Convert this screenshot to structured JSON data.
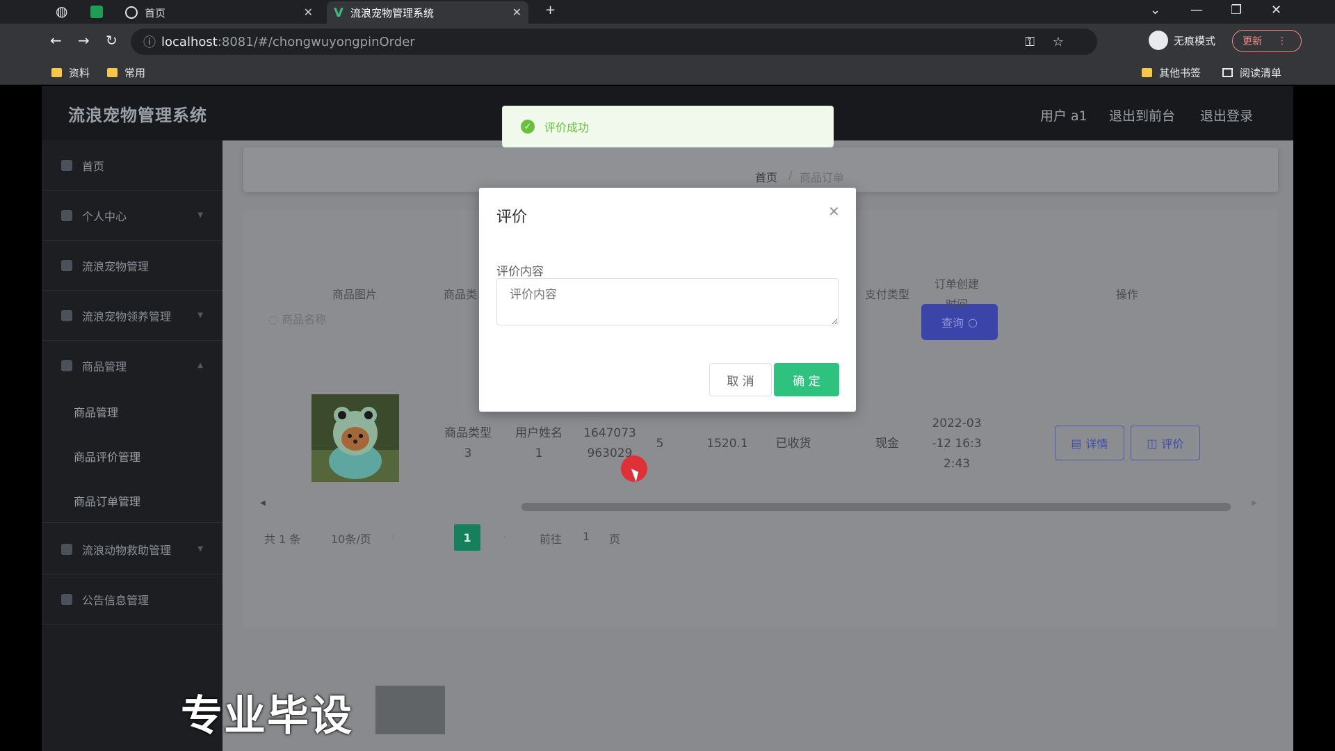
{
  "browser": {
    "tabs": [
      {
        "label": "首页"
      },
      {
        "label": "流浪宠物管理系统"
      }
    ],
    "url_host": "localhost",
    "url_rest": ":8081/#/chongwuyongpinOrder",
    "incognito_label": "无痕模式",
    "update_label": "更新",
    "bookmarks": [
      "资料",
      "常用"
    ],
    "other_bookmarks": "其他书签",
    "reading_list": "阅读清单"
  },
  "app": {
    "title": "流浪宠物管理系统",
    "header_links": [
      "用户 a1",
      "退出到前台",
      "退出登录"
    ]
  },
  "sidebar": {
    "items": [
      {
        "label": "首页"
      },
      {
        "label": "个人中心"
      },
      {
        "label": "流浪宠物管理"
      },
      {
        "label": "流浪宠物领养管理"
      },
      {
        "label": "商品管理"
      },
      {
        "label": "流浪动物救助管理"
      },
      {
        "label": "公告信息管理"
      }
    ],
    "sub_items": [
      "商品管理",
      "商品评价管理",
      "商品订单管理"
    ]
  },
  "breadcrumb": {
    "home": "首页",
    "current": "商品订单"
  },
  "search": {
    "label": "商品名称",
    "query_button": "查询"
  },
  "table": {
    "headers": {
      "image": "商品图片",
      "type": "商品类",
      "pay_type": "支付类型",
      "created_l1": "订单创建",
      "created_l2": "时间",
      "ops": "操作"
    },
    "row": {
      "type_l1": "商品类型",
      "type_l2": "3",
      "user_l1": "用户姓名",
      "user_l2": "1",
      "order_l1": "1647073",
      "order_l2": "963029",
      "qty": "5",
      "price": "1520.1",
      "status": "已收货",
      "pay": "现金",
      "time_l1": "2022-03",
      "time_l2": "-12 16:3",
      "time_l3": "2:43",
      "detail_btn": "详情",
      "review_btn": "评价"
    }
  },
  "pagination": {
    "total": "共 1 条",
    "per_page": "10条/页",
    "current": "1",
    "goto": "前往",
    "goto_value": "1",
    "page_unit": "页"
  },
  "dialog": {
    "title": "评价",
    "field_label": "评价内容",
    "placeholder": "评价内容",
    "cancel": "取 消",
    "confirm": "确 定"
  },
  "toast": {
    "message": "评价成功"
  },
  "watermark": "专业毕设"
}
